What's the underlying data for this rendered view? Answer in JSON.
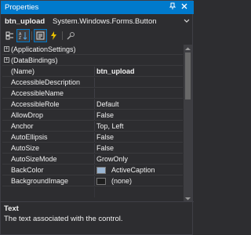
{
  "titlebar": {
    "title": "Properties",
    "pin_icon": "pin-icon",
    "close_icon": "close-icon"
  },
  "object_selector": {
    "name": "btn_upload",
    "type": "System.Windows.Forms.Button"
  },
  "toolbar": {
    "buttons": [
      "categorized-icon",
      "alphabetical-icon",
      "properties-icon",
      "events-icon",
      "property-pages-icon"
    ]
  },
  "properties": [
    {
      "name": "(ApplicationSettings)",
      "value": "",
      "expandable": true
    },
    {
      "name": "(DataBindings)",
      "value": "",
      "expandable": true
    },
    {
      "name": "(Name)",
      "value": "btn_upload",
      "bold_value": true
    },
    {
      "name": "AccessibleDescription",
      "value": ""
    },
    {
      "name": "AccessibleName",
      "value": ""
    },
    {
      "name": "AccessibleRole",
      "value": "Default"
    },
    {
      "name": "AllowDrop",
      "value": "False"
    },
    {
      "name": "Anchor",
      "value": "Top, Left"
    },
    {
      "name": "AutoEllipsis",
      "value": "False"
    },
    {
      "name": "AutoSize",
      "value": "False"
    },
    {
      "name": "AutoSizeMode",
      "value": "GrowOnly"
    },
    {
      "name": "BackColor",
      "value": "ActiveCaption",
      "swatch": "#99b4d1"
    },
    {
      "name": "BackgroundImage",
      "value": "(none)",
      "swatch": "#1e1e1e"
    }
  ],
  "description": {
    "title": "Text",
    "text": "The text associated with the control."
  },
  "colors": {
    "titlebar": "#007acc",
    "background": "#2d2d30",
    "text": "#f1f1f1"
  }
}
